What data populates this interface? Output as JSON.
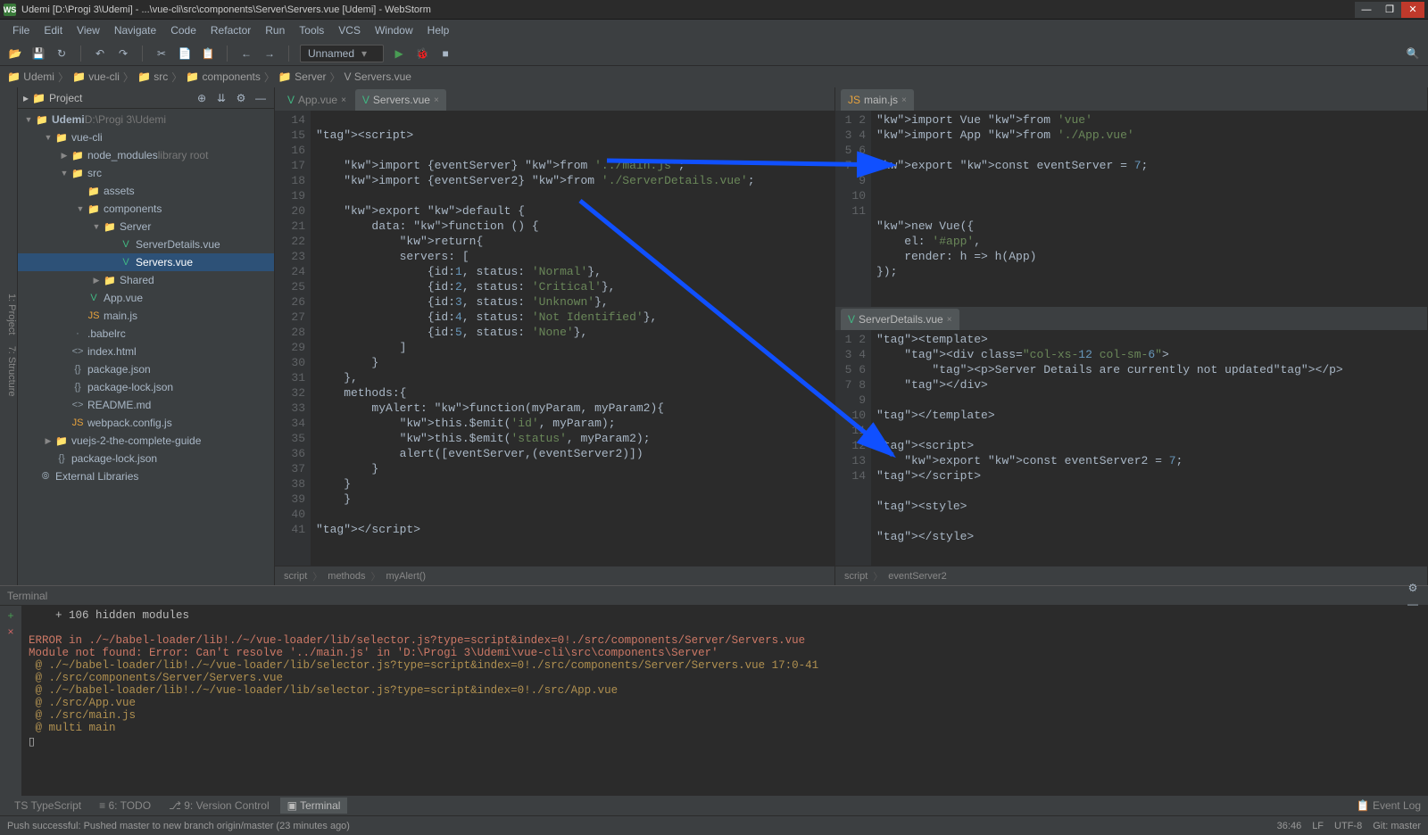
{
  "title": "Udemi [D:\\Progi 3\\Udemi] - ...\\vue-cli\\src\\components\\Server\\Servers.vue [Udemi] - WebStorm",
  "menu": [
    "File",
    "Edit",
    "View",
    "Navigate",
    "Code",
    "Refactor",
    "Run",
    "Tools",
    "VCS",
    "Window",
    "Help"
  ],
  "runconfig": "Unnamed",
  "breadcrumb": [
    "Udemi",
    "vue-cli",
    "src",
    "components",
    "Server",
    "Servers.vue"
  ],
  "project": {
    "label": "Project",
    "root": {
      "name": "Udemi",
      "path": "D:\\Progi 3\\Udemi"
    },
    "tree": [
      {
        "d": 1,
        "arr": "▼",
        "ico": "📁",
        "name": "vue-cli"
      },
      {
        "d": 2,
        "arr": "▶",
        "ico": "📁",
        "name": "node_modules",
        "suffix": "library root"
      },
      {
        "d": 2,
        "arr": "▼",
        "ico": "📁",
        "name": "src"
      },
      {
        "d": 3,
        "arr": "",
        "ico": "📁",
        "name": "assets"
      },
      {
        "d": 3,
        "arr": "▼",
        "ico": "📁",
        "name": "components"
      },
      {
        "d": 4,
        "arr": "▼",
        "ico": "📁",
        "name": "Server"
      },
      {
        "d": 5,
        "arr": "",
        "ico": "V",
        "name": "ServerDetails.vue",
        "vue": true
      },
      {
        "d": 5,
        "arr": "",
        "ico": "V",
        "name": "Servers.vue",
        "vue": true,
        "sel": true
      },
      {
        "d": 4,
        "arr": "▶",
        "ico": "📁",
        "name": "Shared"
      },
      {
        "d": 3,
        "arr": "",
        "ico": "V",
        "name": "App.vue",
        "vue": true
      },
      {
        "d": 3,
        "arr": "",
        "ico": "JS",
        "name": "main.js",
        "js": true
      },
      {
        "d": 2,
        "arr": "",
        "ico": "·",
        "name": ".babelrc"
      },
      {
        "d": 2,
        "arr": "",
        "ico": "<>",
        "name": "index.html"
      },
      {
        "d": 2,
        "arr": "",
        "ico": "{}",
        "name": "package.json"
      },
      {
        "d": 2,
        "arr": "",
        "ico": "{}",
        "name": "package-lock.json"
      },
      {
        "d": 2,
        "arr": "",
        "ico": "<>",
        "name": "README.md"
      },
      {
        "d": 2,
        "arr": "",
        "ico": "JS",
        "name": "webpack.config.js",
        "js": true
      },
      {
        "d": 1,
        "arr": "▶",
        "ico": "📁",
        "name": "vuejs-2-the-complete-guide"
      },
      {
        "d": 1,
        "arr": "",
        "ico": "{}",
        "name": "package-lock.json"
      },
      {
        "d": 0,
        "arr": "",
        "ico": "⦾",
        "name": "External Libraries"
      }
    ]
  },
  "tabs_left": [
    {
      "label": "App.vue",
      "active": false,
      "ico": "V"
    },
    {
      "label": "Servers.vue",
      "active": true,
      "ico": "V"
    }
  ],
  "tabs_right_top": [
    {
      "label": "main.js",
      "active": true,
      "ico": "JS"
    }
  ],
  "tabs_right_bot": [
    {
      "label": "ServerDetails.vue",
      "active": true,
      "ico": "V"
    }
  ],
  "code_left": {
    "start": 14,
    "lines": [
      "",
      "<script>",
      "",
      "    import {eventServer} from '../main.js';",
      "    import {eventServer2} from './ServerDetails.vue';",
      "",
      "    export default {",
      "        data: function () {",
      "            return{",
      "            servers: [",
      "                {id:1, status: 'Normal'},",
      "                {id:2, status: 'Critical'},",
      "                {id:3, status: 'Unknown'},",
      "                {id:4, status: 'Not Identified'},",
      "                {id:5, status: 'None'},",
      "            ]",
      "        }",
      "    },",
      "    methods:{",
      "        myAlert: function(myParam, myParam2){",
      "            this.$emit('id', myParam);",
      "            this.$emit('status', myParam2);",
      "            alert([eventServer,(eventServer2)])",
      "        }",
      "    }",
      "    }",
      "",
      "</script>"
    ]
  },
  "crumb_left": [
    "script",
    "methods",
    "myAlert()"
  ],
  "code_right_top": {
    "start": 1,
    "lines": [
      "import Vue from 'vue'",
      "import App from './App.vue'",
      "",
      "export const eventServer = 7;",
      "",
      "",
      "",
      "new Vue({",
      "    el: '#app',",
      "    render: h => h(App)",
      "});"
    ]
  },
  "code_right_bot": {
    "start": 1,
    "lines": [
      "<template>",
      "    <div class=\"col-xs-12 col-sm-6\">",
      "        <p>Server Details are currently not updated</p>",
      "    </div>",
      "",
      "</template>",
      "",
      "<script>",
      "    export const eventServer2 = 7;",
      "</script>",
      "",
      "<style>",
      "",
      "</style>"
    ]
  },
  "crumb_right": [
    "script",
    "eventServer2"
  ],
  "terminal": {
    "label": "Terminal",
    "lines": [
      {
        "t": "    + 106 hidden modules",
        "c": ""
      },
      {
        "t": "",
        "c": ""
      },
      {
        "t": "ERROR in ./~/babel-loader/lib!./~/vue-loader/lib/selector.js?type=script&index=0!./src/components/Server/Servers.vue",
        "c": "err"
      },
      {
        "t": "Module not found: Error: Can't resolve '../main.js' in 'D:\\Progi 3\\Udemi\\vue-cli\\src\\components\\Server'",
        "c": "err"
      },
      {
        "t": " @ ./~/babel-loader/lib!./~/vue-loader/lib/selector.js?type=script&index=0!./src/components/Server/Servers.vue 17:0-41",
        "c": "warn"
      },
      {
        "t": " @ ./src/components/Server/Servers.vue",
        "c": "warn"
      },
      {
        "t": " @ ./~/babel-loader/lib!./~/vue-loader/lib/selector.js?type=script&index=0!./src/App.vue",
        "c": "warn"
      },
      {
        "t": " @ ./src/App.vue",
        "c": "warn"
      },
      {
        "t": " @ ./src/main.js",
        "c": "warn"
      },
      {
        "t": " @ multi main",
        "c": "warn"
      },
      {
        "t": "▯",
        "c": ""
      }
    ]
  },
  "bottom_tabs": [
    {
      "label": "TypeScript",
      "ico": "TS"
    },
    {
      "label": "6: TODO",
      "ico": "≡"
    },
    {
      "label": "9: Version Control",
      "ico": "⎇"
    },
    {
      "label": "Terminal",
      "ico": "▣",
      "active": true
    }
  ],
  "event_log": "Event Log",
  "status_msg": "Push successful: Pushed master to new branch origin/master (23 minutes ago)",
  "status_right": [
    "36:46",
    "LF",
    "UTF-8",
    "Git: master"
  ]
}
